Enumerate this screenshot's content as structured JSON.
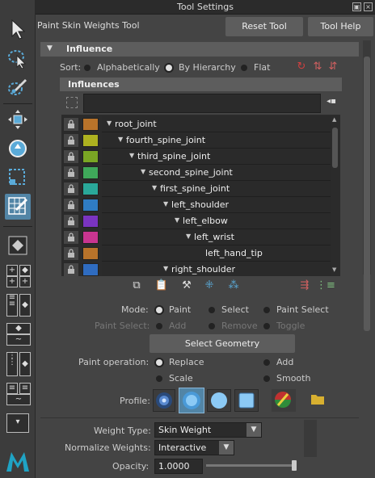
{
  "window": {
    "title": "Tool Settings"
  },
  "tool": {
    "name": "Paint Skin Weights Tool",
    "reset_label": "Reset Tool",
    "help_label": "Tool Help"
  },
  "influence": {
    "section_title": "Influence",
    "sort_label": "Sort:",
    "sort_options": [
      "Alphabetically",
      "By Hierarchy",
      "Flat"
    ],
    "sort_selected": "By Hierarchy",
    "list_title": "Influences",
    "search_value": "",
    "joints": [
      {
        "name": "root_joint",
        "color": "#b8732a"
      },
      {
        "name": "fourth_spine_joint",
        "color": "#aeb220"
      },
      {
        "name": "third_spine_joint",
        "color": "#7aa624"
      },
      {
        "name": "second_spine_joint",
        "color": "#3fa85a"
      },
      {
        "name": "first_spine_joint",
        "color": "#2aa89a"
      },
      {
        "name": "left_shoulder",
        "color": "#2f7cc4"
      },
      {
        "name": "left_elbow",
        "color": "#7a34c0"
      },
      {
        "name": "left_wrist",
        "color": "#c83590"
      },
      {
        "name": "left_hand_tip",
        "color": "#b8732a"
      },
      {
        "name": "right_shoulder",
        "color": "#2f6cc0"
      }
    ]
  },
  "mode": {
    "label": "Mode:",
    "options": [
      "Paint",
      "Select",
      "Paint Select"
    ],
    "selected": "Paint",
    "paint_select_label": "Paint Select:",
    "paint_select_options": [
      "Add",
      "Remove",
      "Toggle"
    ],
    "select_geometry_label": "Select Geometry"
  },
  "paint_operation": {
    "label": "Paint operation:",
    "options": [
      "Replace",
      "Add",
      "Scale",
      "Smooth"
    ],
    "selected": "Replace"
  },
  "profile": {
    "label": "Profile:"
  },
  "weights": {
    "weight_type_label": "Weight Type:",
    "weight_type_value": "Skin Weight",
    "normalize_label": "Normalize Weights:",
    "normalize_value": "Interactive",
    "opacity_label": "Opacity:",
    "opacity_value": "1.0000",
    "opacity_level": 1.0
  }
}
